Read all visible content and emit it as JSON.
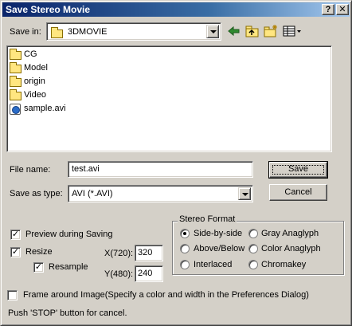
{
  "window": {
    "title": "Save Stereo Movie",
    "help_glyph": "?",
    "close_glyph": "✕"
  },
  "save_in": {
    "label": "Save in:",
    "value": "3DMOVIE"
  },
  "files": [
    {
      "name": "CG",
      "type": "folder"
    },
    {
      "name": "Model",
      "type": "folder"
    },
    {
      "name": "origin",
      "type": "folder"
    },
    {
      "name": "Video",
      "type": "folder"
    },
    {
      "name": "sample.avi",
      "type": "avi"
    }
  ],
  "file_name": {
    "label": "File name:",
    "value": "test.avi"
  },
  "save_as_type": {
    "label": "Save as type:",
    "value": "AVI (*.AVI)"
  },
  "buttons": {
    "save": "Save",
    "cancel": "Cancel"
  },
  "options": {
    "preview": {
      "label": "Preview during Saving",
      "checked": true
    },
    "resize": {
      "label": "Resize",
      "checked": true
    },
    "resample": {
      "label": "Resample",
      "checked": true
    },
    "x_label": "X(720):",
    "x_value": "320",
    "y_label": "Y(480):",
    "y_value": "240",
    "frame_around": {
      "label": "Frame around Image(Specify a color and width in the Preferences Dialog)",
      "checked": false
    }
  },
  "stereo_format": {
    "title": "Stereo Format",
    "side_by_side": "Side-by-side",
    "gray_anaglyph": "Gray Anaglyph",
    "above_below": "Above/Below",
    "color_anaglyph": "Color Anaglyph",
    "interlaced": "Interlaced",
    "chromakey": "Chromakey",
    "selected": "Side-by-side"
  },
  "status_text": "Push 'STOP' button for cancel.",
  "colors": {
    "title_start": "#0a246a",
    "title_end": "#a6caf0",
    "face": "#d4d0c8",
    "folder_yellow": "#ffe680"
  }
}
